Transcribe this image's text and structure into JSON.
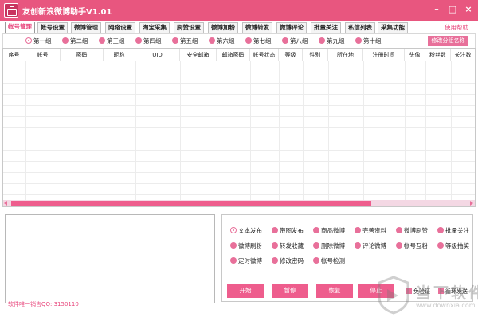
{
  "window": {
    "title": "友创新浪微博助手V1.01"
  },
  "tabs": [
    {
      "label": "帐号管理",
      "active": true
    },
    {
      "label": "帐号设置"
    },
    {
      "label": "微博管理"
    },
    {
      "label": "网络设置"
    },
    {
      "label": "淘宝采集"
    },
    {
      "label": "刷赞设置"
    },
    {
      "label": "微博加粉"
    },
    {
      "label": "微博转发"
    },
    {
      "label": "微博评论"
    },
    {
      "label": "批量关注"
    },
    {
      "label": "私信列表"
    },
    {
      "label": "采集功能"
    }
  ],
  "help_label": "使用帮助",
  "groups": {
    "items": [
      "第一组",
      "第二组",
      "第三组",
      "第四组",
      "第五组",
      "第六组",
      "第七组",
      "第八组",
      "第九组",
      "第十组"
    ],
    "selected": "第一组",
    "rename_label": "修改分组名称"
  },
  "table": {
    "columns": [
      "序号",
      "帐号",
      "密码",
      "昵称",
      "UID",
      "安全邮箱",
      "邮箱密码",
      "帐号状态",
      "等级",
      "性别",
      "所在地",
      "注册时间",
      "头像",
      "粉丝数",
      "关注数"
    ],
    "rows": []
  },
  "functions": {
    "items": [
      "文本发布",
      "带图发布",
      "商品微博",
      "完善资料",
      "微博刷赞",
      "批量关注",
      "微博刷粉",
      "转发收藏",
      "删除微博",
      "评论微博",
      "帐号互粉",
      "等级抽奖",
      "定时微博",
      "修改密码",
      "帐号检测"
    ],
    "selected": "文本发布"
  },
  "actions": {
    "start": "开始",
    "pause": "暂停",
    "resume": "恢复",
    "stop": "停止"
  },
  "options": {
    "verify": "免验证",
    "loop": "循环发送"
  },
  "software_id": "软件唯一销售QQ: 3150110",
  "watermark": {
    "text": "当下软件园",
    "url": "www.downxia.com"
  },
  "colors": {
    "accent": "#e8567f",
    "pink_light": "#e8709a"
  }
}
